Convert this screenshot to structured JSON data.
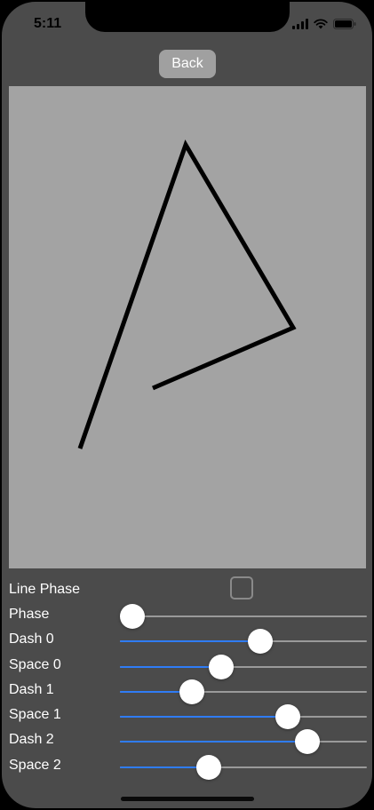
{
  "status_bar": {
    "time": "5:11",
    "icons": [
      "cellular-icon",
      "wifi-icon",
      "battery-icon"
    ]
  },
  "nav": {
    "back_label": "Back"
  },
  "drawing": {
    "stroke_color": "#000000",
    "background_color": "#a3a3a3"
  },
  "controls": {
    "line_phase": {
      "label": "Line Phase",
      "checked": false
    },
    "sliders": [
      {
        "name": "phase",
        "label": "Phase",
        "value": 0.05
      },
      {
        "name": "dash-0",
        "label": "Dash 0",
        "value": 0.57
      },
      {
        "name": "space-0",
        "label": "Space 0",
        "value": 0.41
      },
      {
        "name": "dash-1",
        "label": "Dash 1",
        "value": 0.29
      },
      {
        "name": "space-1",
        "label": "Space 1",
        "value": 0.68
      },
      {
        "name": "dash-2",
        "label": "Dash 2",
        "value": 0.76
      },
      {
        "name": "space-2",
        "label": "Space 2",
        "value": 0.36
      }
    ]
  },
  "colors": {
    "accent": "#2f7cf6",
    "screen_bg": "#4b4b4b",
    "track": "#9a9a9a"
  }
}
